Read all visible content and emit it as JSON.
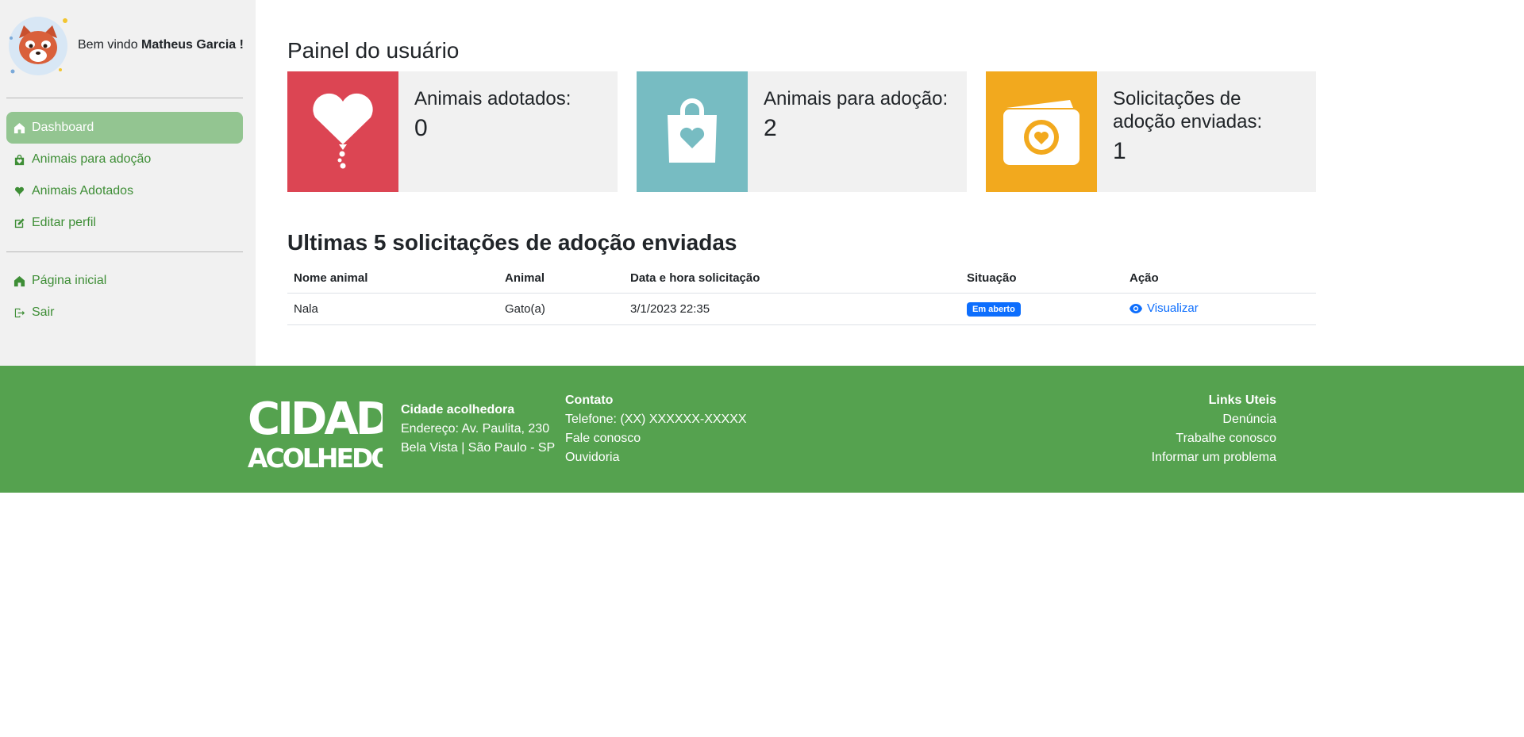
{
  "sidebar": {
    "greeting_prefix": "Bem vindo",
    "user_name": "Matheus Garcia !",
    "nav": [
      {
        "label": "Dashboard",
        "icon": "house-icon",
        "active": true
      },
      {
        "label": "Animais para adoção",
        "icon": "bag-heart-icon",
        "active": false
      },
      {
        "label": "Animais Adotados",
        "icon": "heart-icon",
        "active": false
      },
      {
        "label": "Editar perfil",
        "icon": "edit-icon",
        "active": false
      }
    ],
    "nav2": [
      {
        "label": "Página inicial",
        "icon": "house-icon"
      },
      {
        "label": "Sair",
        "icon": "exit-icon"
      }
    ]
  },
  "main": {
    "title": "Painel do usuário",
    "cards": [
      {
        "label": "Animais adotados:",
        "count": "0",
        "color": "#dc4553",
        "icon": "heart-balloon-icon"
      },
      {
        "label": "Animais para adoção:",
        "count": "2",
        "color": "#77bcc2",
        "icon": "bag-heart-icon"
      },
      {
        "label": "Solicitações de adoção enviadas:",
        "count": "1",
        "color": "#f2a91e",
        "icon": "wallet-heart-icon"
      }
    ],
    "section_title": "Ultimas 5 solicitações de adoção enviadas",
    "table": {
      "headers": [
        "Nome animal",
        "Animal",
        "Data e hora solicitação",
        "Situação",
        "Ação"
      ],
      "rows": [
        {
          "nome": "Nala",
          "animal": "Gato(a)",
          "data": "3/1/2023 22:35",
          "situacao": "Em aberto",
          "acao": "Visualizar"
        }
      ]
    }
  },
  "footer": {
    "logo_text_top": "CIDADE",
    "logo_text_bottom": "ACOLHEDORA",
    "org_name": "Cidade acolhedora",
    "address_line1": "Endereço: Av. Paulita, 230",
    "address_line2": "Bela Vista | São Paulo - SP",
    "contact_title": "Contato",
    "contact_items": [
      "Telefone: (XX) XXXXXX-XXXXX",
      "Fale conosco",
      "Ouvidoria"
    ],
    "links_title": "Links Uteis",
    "links": [
      "Denúncia",
      "Trabalhe conosco",
      "Informar um problema"
    ]
  },
  "colors": {
    "accent_green": "#55a24f",
    "nav_green": "#3e8e36",
    "active_bg": "#93c591",
    "badge_blue": "#0d6efd"
  }
}
